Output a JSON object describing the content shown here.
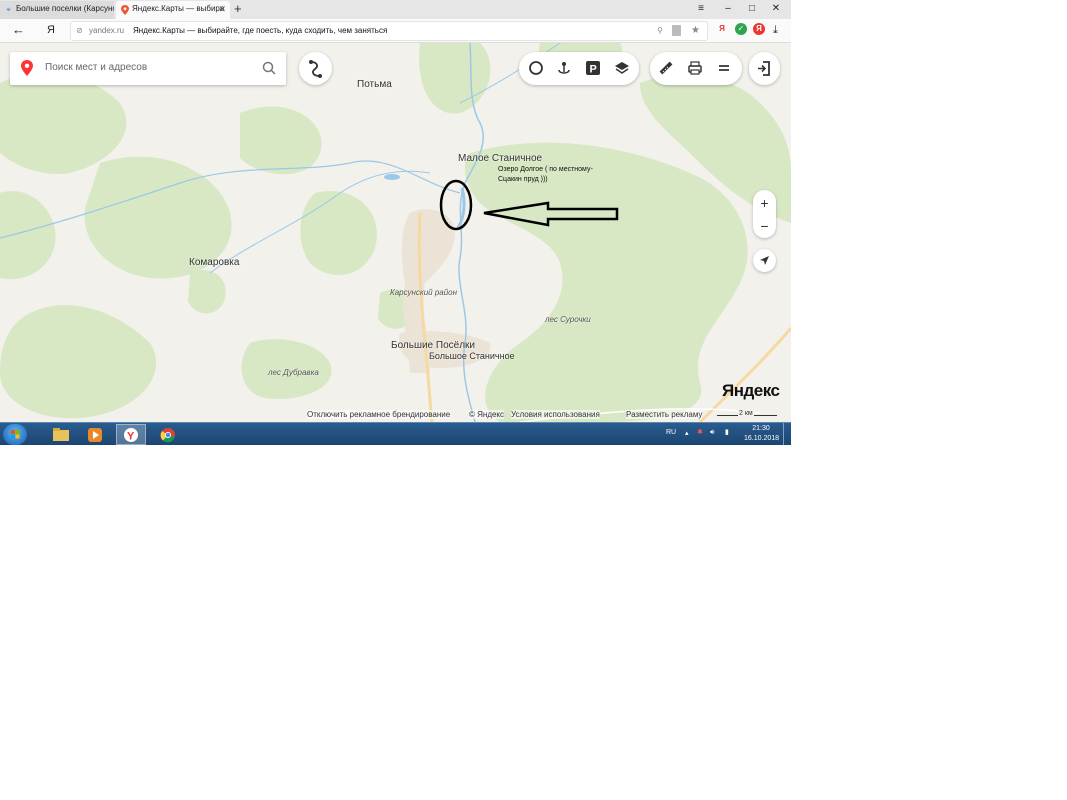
{
  "browser": {
    "tabs": [
      {
        "title": "Большие поселки (Карсунс",
        "favicon": "globe-icon"
      },
      {
        "title": "Яндекс.Карты — выбира",
        "favicon": "yandex-maps-pin-icon"
      }
    ],
    "new_tab": "+",
    "window_controls": [
      "≡",
      "–",
      "□",
      "✕"
    ],
    "nav": {
      "back": "←",
      "yandex_home": "Я"
    },
    "url_domain": "yandex.ru",
    "url_title": "Яндекс.Карты — выбирайте, где поесть, куда сходить, чем заняться",
    "extensions": [
      "Я",
      "✓",
      "Я"
    ]
  },
  "map": {
    "search": {
      "placeholder": "Поиск мест и адресов",
      "value": ""
    },
    "toolbar_icons": [
      "routes-icon",
      "traffic-icon",
      "panorama-icon",
      "parking-icon",
      "layers-icon",
      "ruler-icon",
      "print-icon",
      "menu-icon",
      "login-icon"
    ],
    "zoom_in": "+",
    "zoom_out": "−",
    "labels": {
      "potma": "Потьма",
      "maloe": "Малое Станичное",
      "komarovka": "Комаровка",
      "karsun": "Карсунский район",
      "les_surochki": "лес Сурочки",
      "bolshie": "Большие Посёлки",
      "bolshoe": "Большое Станичное",
      "les_dubravka": "лес Дубравка"
    },
    "annotation": {
      "line1": "Озеро Долгое ( по местному-",
      "line2": "Сцакин пруд )))"
    },
    "footer": {
      "branding": "Отключить рекламное брендирование",
      "copyright": "© Яндекс",
      "terms": "Условия использования",
      "ads": "Разместить рекламу"
    },
    "logo": "Яндекс",
    "scale": "2 км",
    "colors": {
      "forest": "#d8e8c4",
      "water": "#9cc8e6",
      "background": "#f3f1ec",
      "town": "#ebe4d6",
      "road": "#f6d9a0"
    }
  },
  "taskbar": {
    "apps": [
      "file-explorer-icon",
      "media-player-icon",
      "yandex-browser-icon",
      "chrome-icon"
    ],
    "language": "RU",
    "time": "21:30",
    "date": "16.10.2018"
  }
}
